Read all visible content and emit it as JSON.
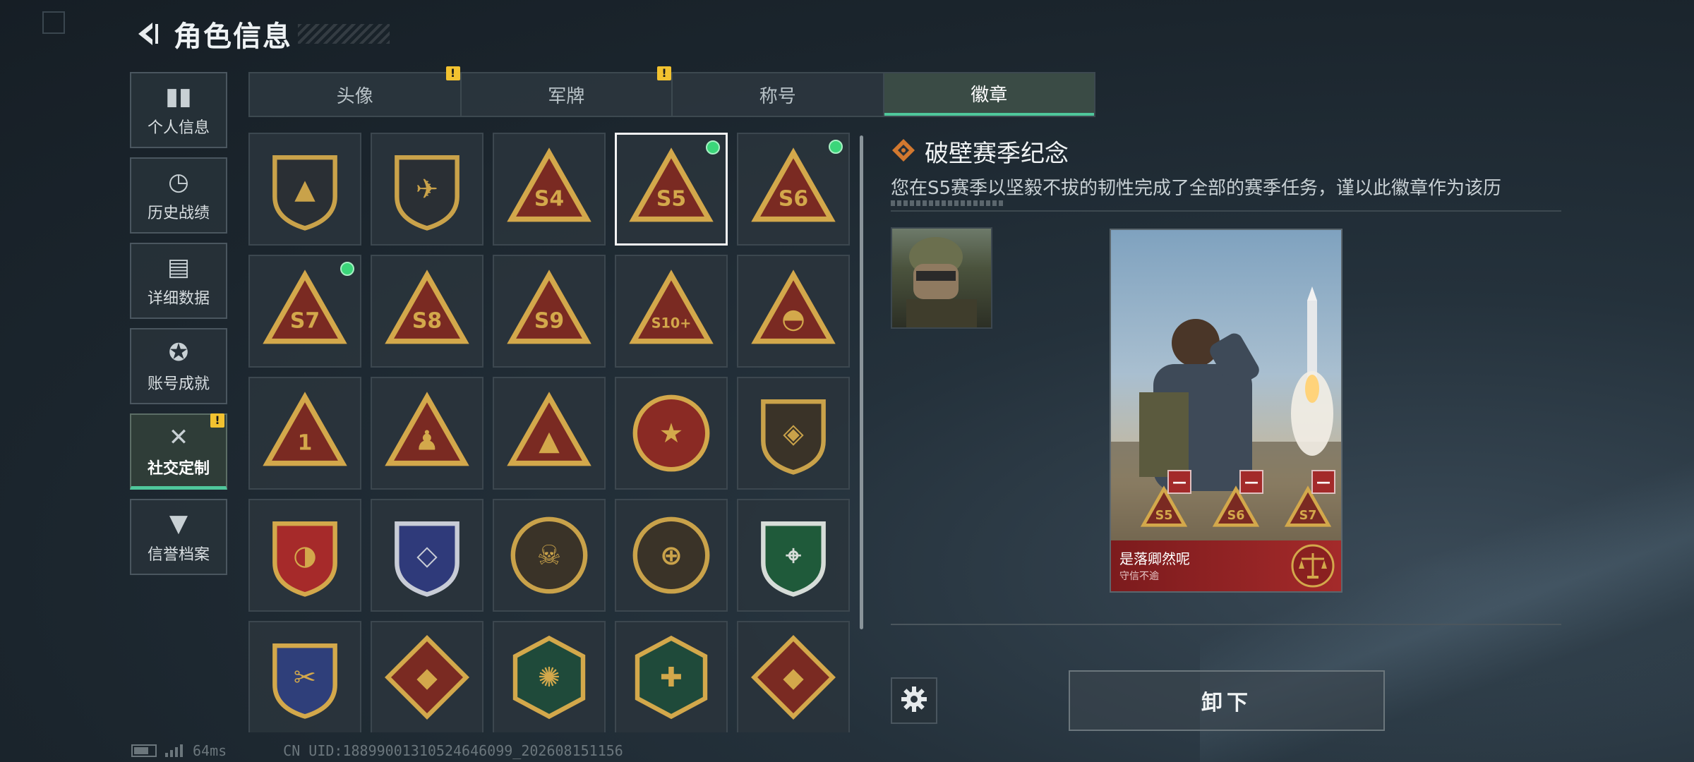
{
  "header": {
    "back_icon": "back-arrow-icon",
    "title": "角色信息"
  },
  "sidebar": {
    "items": [
      {
        "label": "个人信息",
        "icon": "bar-chart-icon",
        "glyph": "▮▮",
        "active": false,
        "warn": false
      },
      {
        "label": "历史战绩",
        "icon": "history-clock-icon",
        "glyph": "◷",
        "active": false,
        "warn": false
      },
      {
        "label": "详细数据",
        "icon": "data-folder-icon",
        "glyph": "▤",
        "active": false,
        "warn": false
      },
      {
        "label": "账号成就",
        "icon": "achievement-medal-icon",
        "glyph": "✪",
        "active": false,
        "warn": false
      },
      {
        "label": "社交定制",
        "icon": "tools-icon",
        "glyph": "✕",
        "active": true,
        "warn": true
      },
      {
        "label": "信誉档案",
        "icon": "reputation-shield-icon",
        "glyph": "▼",
        "active": false,
        "warn": false
      }
    ],
    "warn_symbol": "!"
  },
  "tabs": [
    {
      "label": "头像",
      "warn": true,
      "active": false
    },
    {
      "label": "军牌",
      "warn": true,
      "active": false
    },
    {
      "label": "称号",
      "warn": false,
      "active": false
    },
    {
      "label": "徽章",
      "warn": false,
      "active": true
    }
  ],
  "badges": [
    {
      "name": "triangle-emblem-badge",
      "shape": "shield",
      "fill": "#2a2f34",
      "stroke": "#c9a24a",
      "inner": "▲",
      "label": "",
      "selected": false,
      "new": false
    },
    {
      "name": "helicopter-badge",
      "shape": "shield",
      "fill": "#2a2f34",
      "stroke": "#c9a24a",
      "inner": "✈",
      "label": "",
      "selected": false,
      "new": false
    },
    {
      "name": "season-s4-badge",
      "shape": "triangle",
      "fill": "#7a2a22",
      "stroke": "#d3a84b",
      "inner": "",
      "label": "S4",
      "selected": false,
      "new": false
    },
    {
      "name": "season-s5-badge",
      "shape": "triangle",
      "fill": "#7a2a22",
      "stroke": "#d3a84b",
      "inner": "",
      "label": "S5",
      "selected": true,
      "new": true
    },
    {
      "name": "season-s6-badge",
      "shape": "triangle",
      "fill": "#7a2a22",
      "stroke": "#d3a84b",
      "inner": "",
      "label": "S6",
      "selected": false,
      "new": true
    },
    {
      "name": "season-s7-badge",
      "shape": "triangle",
      "fill": "#7a2a22",
      "stroke": "#d3a84b",
      "inner": "",
      "label": "S7",
      "selected": false,
      "new": true
    },
    {
      "name": "season-s8-badge",
      "shape": "triangle",
      "fill": "#7a2a22",
      "stroke": "#d3a84b",
      "inner": "",
      "label": "S8",
      "selected": false,
      "new": false
    },
    {
      "name": "season-s9-badge",
      "shape": "triangle",
      "fill": "#7a2a22",
      "stroke": "#d3a84b",
      "inner": "",
      "label": "S9",
      "selected": false,
      "new": false
    },
    {
      "name": "season-s10-badge",
      "shape": "triangle",
      "fill": "#7a2a22",
      "stroke": "#d3a84b",
      "inner": "",
      "label": "S10+",
      "selected": false,
      "new": false
    },
    {
      "name": "nest-badge",
      "shape": "triangle",
      "fill": "#7a2a22",
      "stroke": "#d3a84b",
      "inner": "◓",
      "label": "",
      "selected": false,
      "new": false
    },
    {
      "name": "number-one-badge",
      "shape": "triangle",
      "fill": "#7a2a22",
      "stroke": "#d3a84b",
      "inner": "",
      "label": "1",
      "selected": false,
      "new": false
    },
    {
      "name": "squad-badge",
      "shape": "triangle",
      "fill": "#7a2a22",
      "stroke": "#d3a84b",
      "inner": "♟",
      "label": "",
      "selected": false,
      "new": false
    },
    {
      "name": "rocket-badge",
      "shape": "triangle",
      "fill": "#7a2a22",
      "stroke": "#d3a84b",
      "inner": "▲",
      "label": "",
      "selected": false,
      "new": false
    },
    {
      "name": "star-skull-badge",
      "shape": "circle",
      "fill": "#8a2a24",
      "stroke": "#d3a84b",
      "inner": "★",
      "label": "",
      "selected": false,
      "new": false
    },
    {
      "name": "chevron-shield-badge",
      "shape": "shield",
      "fill": "#3a3328",
      "stroke": "#c9a24a",
      "inner": "◈",
      "label": "",
      "selected": false,
      "new": false
    },
    {
      "name": "red-star-shield-badge",
      "shape": "shield",
      "fill": "#a62a2a",
      "stroke": "#d3a84b",
      "inner": "◑",
      "label": "",
      "selected": false,
      "new": false
    },
    {
      "name": "diamond-shield-badge",
      "shape": "shield",
      "fill": "#2f3a7a",
      "stroke": "#c8ccd6",
      "inner": "◇",
      "label": "",
      "selected": false,
      "new": false
    },
    {
      "name": "skull-scope-badge",
      "shape": "circle",
      "fill": "#3a3328",
      "stroke": "#c9a24a",
      "inner": "☠",
      "label": "",
      "selected": false,
      "new": false
    },
    {
      "name": "crosshair-skull-badge",
      "shape": "circle",
      "fill": "#3a3328",
      "stroke": "#c9a24a",
      "inner": "⊕",
      "label": "",
      "selected": false,
      "new": false
    },
    {
      "name": "rifle-scope-badge",
      "shape": "shield",
      "fill": "#1f5a3a",
      "stroke": "#d6dcd8",
      "inner": "⌖",
      "label": "",
      "selected": false,
      "new": false
    },
    {
      "name": "knife-scope-badge",
      "shape": "shield",
      "fill": "#2f3f7a",
      "stroke": "#d3a84b",
      "inner": "✂",
      "label": "",
      "selected": false,
      "new": false
    },
    {
      "name": "wolf-badge",
      "shape": "diamond",
      "fill": "#7a2a22",
      "stroke": "#d3a84b",
      "inner": "◆",
      "label": "",
      "selected": false,
      "new": false
    },
    {
      "name": "hornet-badge",
      "shape": "hexagon",
      "fill": "#1f4a3a",
      "stroke": "#d3a84b",
      "inner": "✺",
      "label": "",
      "selected": false,
      "new": false
    },
    {
      "name": "medic-badge",
      "shape": "hexagon",
      "fill": "#1f4a3a",
      "stroke": "#d3a84b",
      "inner": "✚",
      "label": "",
      "selected": false,
      "new": false
    },
    {
      "name": "dragon-badge",
      "shape": "diamond",
      "fill": "#7a2a22",
      "stroke": "#d3a84b",
      "inner": "◆",
      "label": "",
      "selected": false,
      "new": false
    }
  ],
  "detail": {
    "title_icon": "badge-diamond-icon",
    "title": "破壁赛季纪念",
    "description": "您在S5赛季以坚毅不拔的韧性完成了全部的赛季任务，谨以此徽章作为该历",
    "preview": {
      "player_name": "是落卿然呢",
      "player_subtitle": "守信不逾",
      "slot_labels": [
        "S5",
        "S6",
        "S7"
      ],
      "remove_symbol": "—",
      "emblem_icon": "scales-emblem-icon"
    },
    "action_label": "卸下",
    "settings_icon": "gear-icon"
  },
  "status": {
    "ping": "64ms",
    "uid": "CN UID:1889900131052464609​9_202608151156"
  },
  "colors": {
    "accent": "#4fc79b",
    "warn": "#f2c230",
    "new_dot": "#3bd67a"
  }
}
